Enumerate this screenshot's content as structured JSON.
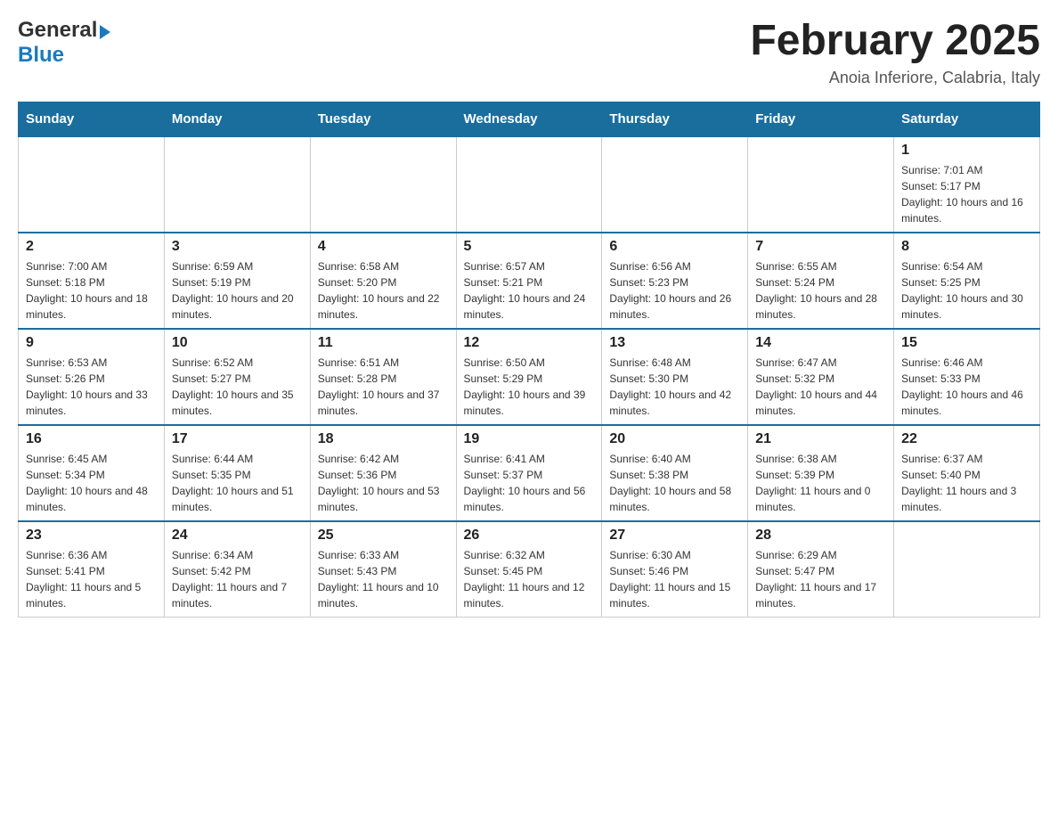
{
  "logo": {
    "general": "General",
    "blue": "Blue",
    "triangle": "▶"
  },
  "title": "February 2025",
  "location": "Anoia Inferiore, Calabria, Italy",
  "days_of_week": [
    "Sunday",
    "Monday",
    "Tuesday",
    "Wednesday",
    "Thursday",
    "Friday",
    "Saturday"
  ],
  "weeks": [
    [
      {
        "day": "",
        "info": ""
      },
      {
        "day": "",
        "info": ""
      },
      {
        "day": "",
        "info": ""
      },
      {
        "day": "",
        "info": ""
      },
      {
        "day": "",
        "info": ""
      },
      {
        "day": "",
        "info": ""
      },
      {
        "day": "1",
        "info": "Sunrise: 7:01 AM\nSunset: 5:17 PM\nDaylight: 10 hours and 16 minutes."
      }
    ],
    [
      {
        "day": "2",
        "info": "Sunrise: 7:00 AM\nSunset: 5:18 PM\nDaylight: 10 hours and 18 minutes."
      },
      {
        "day": "3",
        "info": "Sunrise: 6:59 AM\nSunset: 5:19 PM\nDaylight: 10 hours and 20 minutes."
      },
      {
        "day": "4",
        "info": "Sunrise: 6:58 AM\nSunset: 5:20 PM\nDaylight: 10 hours and 22 minutes."
      },
      {
        "day": "5",
        "info": "Sunrise: 6:57 AM\nSunset: 5:21 PM\nDaylight: 10 hours and 24 minutes."
      },
      {
        "day": "6",
        "info": "Sunrise: 6:56 AM\nSunset: 5:23 PM\nDaylight: 10 hours and 26 minutes."
      },
      {
        "day": "7",
        "info": "Sunrise: 6:55 AM\nSunset: 5:24 PM\nDaylight: 10 hours and 28 minutes."
      },
      {
        "day": "8",
        "info": "Sunrise: 6:54 AM\nSunset: 5:25 PM\nDaylight: 10 hours and 30 minutes."
      }
    ],
    [
      {
        "day": "9",
        "info": "Sunrise: 6:53 AM\nSunset: 5:26 PM\nDaylight: 10 hours and 33 minutes."
      },
      {
        "day": "10",
        "info": "Sunrise: 6:52 AM\nSunset: 5:27 PM\nDaylight: 10 hours and 35 minutes."
      },
      {
        "day": "11",
        "info": "Sunrise: 6:51 AM\nSunset: 5:28 PM\nDaylight: 10 hours and 37 minutes."
      },
      {
        "day": "12",
        "info": "Sunrise: 6:50 AM\nSunset: 5:29 PM\nDaylight: 10 hours and 39 minutes."
      },
      {
        "day": "13",
        "info": "Sunrise: 6:48 AM\nSunset: 5:30 PM\nDaylight: 10 hours and 42 minutes."
      },
      {
        "day": "14",
        "info": "Sunrise: 6:47 AM\nSunset: 5:32 PM\nDaylight: 10 hours and 44 minutes."
      },
      {
        "day": "15",
        "info": "Sunrise: 6:46 AM\nSunset: 5:33 PM\nDaylight: 10 hours and 46 minutes."
      }
    ],
    [
      {
        "day": "16",
        "info": "Sunrise: 6:45 AM\nSunset: 5:34 PM\nDaylight: 10 hours and 48 minutes."
      },
      {
        "day": "17",
        "info": "Sunrise: 6:44 AM\nSunset: 5:35 PM\nDaylight: 10 hours and 51 minutes."
      },
      {
        "day": "18",
        "info": "Sunrise: 6:42 AM\nSunset: 5:36 PM\nDaylight: 10 hours and 53 minutes."
      },
      {
        "day": "19",
        "info": "Sunrise: 6:41 AM\nSunset: 5:37 PM\nDaylight: 10 hours and 56 minutes."
      },
      {
        "day": "20",
        "info": "Sunrise: 6:40 AM\nSunset: 5:38 PM\nDaylight: 10 hours and 58 minutes."
      },
      {
        "day": "21",
        "info": "Sunrise: 6:38 AM\nSunset: 5:39 PM\nDaylight: 11 hours and 0 minutes."
      },
      {
        "day": "22",
        "info": "Sunrise: 6:37 AM\nSunset: 5:40 PM\nDaylight: 11 hours and 3 minutes."
      }
    ],
    [
      {
        "day": "23",
        "info": "Sunrise: 6:36 AM\nSunset: 5:41 PM\nDaylight: 11 hours and 5 minutes."
      },
      {
        "day": "24",
        "info": "Sunrise: 6:34 AM\nSunset: 5:42 PM\nDaylight: 11 hours and 7 minutes."
      },
      {
        "day": "25",
        "info": "Sunrise: 6:33 AM\nSunset: 5:43 PM\nDaylight: 11 hours and 10 minutes."
      },
      {
        "day": "26",
        "info": "Sunrise: 6:32 AM\nSunset: 5:45 PM\nDaylight: 11 hours and 12 minutes."
      },
      {
        "day": "27",
        "info": "Sunrise: 6:30 AM\nSunset: 5:46 PM\nDaylight: 11 hours and 15 minutes."
      },
      {
        "day": "28",
        "info": "Sunrise: 6:29 AM\nSunset: 5:47 PM\nDaylight: 11 hours and 17 minutes."
      },
      {
        "day": "",
        "info": ""
      }
    ]
  ]
}
